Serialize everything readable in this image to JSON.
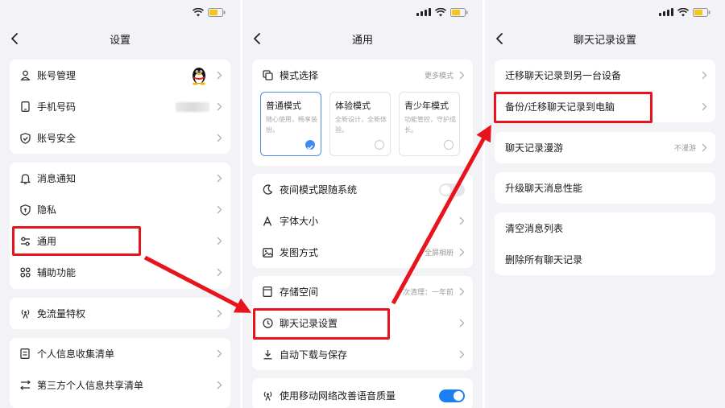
{
  "panel1": {
    "title": "设置",
    "group1": [
      "账号管理",
      "手机号码",
      "账号安全"
    ],
    "group2": [
      "消息通知",
      "隐私",
      "通用",
      "辅助功能"
    ],
    "group3": [
      "免流量特权"
    ],
    "group4": [
      "个人信息收集清单",
      "第三方个人信息共享清单"
    ]
  },
  "panel2": {
    "title": "通用",
    "mode_header": "模式选择",
    "mode_more": "更多模式",
    "modes": [
      {
        "title": "普通模式",
        "desc": "随心使用，畅享装扮。"
      },
      {
        "title": "体验模式",
        "desc": "全新设计，全新体验。"
      },
      {
        "title": "青少年模式",
        "desc": "功能管控，守护成长。"
      }
    ],
    "night_mode": "夜间模式跟随系统",
    "font_size": "字体大小",
    "photo_mode": "发图方式",
    "photo_mode_value": "全屏相册",
    "storage": "存储空间",
    "storage_value": "次清理：一年前",
    "chat_record": "聊天记录设置",
    "auto_download": "自动下载与保存",
    "voice_quality": "使用移动网络改善语音质量"
  },
  "panel3": {
    "title": "聊天记录设置",
    "migrate_device": "迁移聊天记录到另一台设备",
    "backup_pc": "备份/迁移聊天记录到电脑",
    "roaming": "聊天记录漫游",
    "roaming_value": "不漫游",
    "upgrade": "升级聊天消息性能",
    "clear_list": "清空消息列表",
    "delete_all": "删除所有聊天记录"
  },
  "colors": {
    "highlight": "#e8131d",
    "accent_blue": "#1a7ff2",
    "battery": "#f5c518"
  }
}
